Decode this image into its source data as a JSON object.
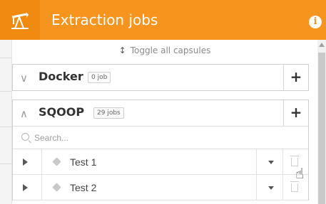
{
  "header": {
    "title": "Extraction jobs",
    "info_glyph": "i",
    "logo_icon": "oil-pump-jack-icon",
    "colors": {
      "header_bg": "#f7941d",
      "logo_bg": "#f08a10"
    }
  },
  "toolbar": {
    "toggle_label": "Toggle all capsules"
  },
  "capsules": [
    {
      "name": "Docker",
      "badge": "0 job",
      "expanded": false,
      "add_label": "+"
    },
    {
      "name": "SQOOP",
      "badge": "29 jobs",
      "expanded": true,
      "add_label": "+"
    }
  ],
  "search": {
    "placeholder": "Search..."
  },
  "jobs": [
    {
      "name": "Test 1"
    },
    {
      "name": "Test 2"
    }
  ]
}
